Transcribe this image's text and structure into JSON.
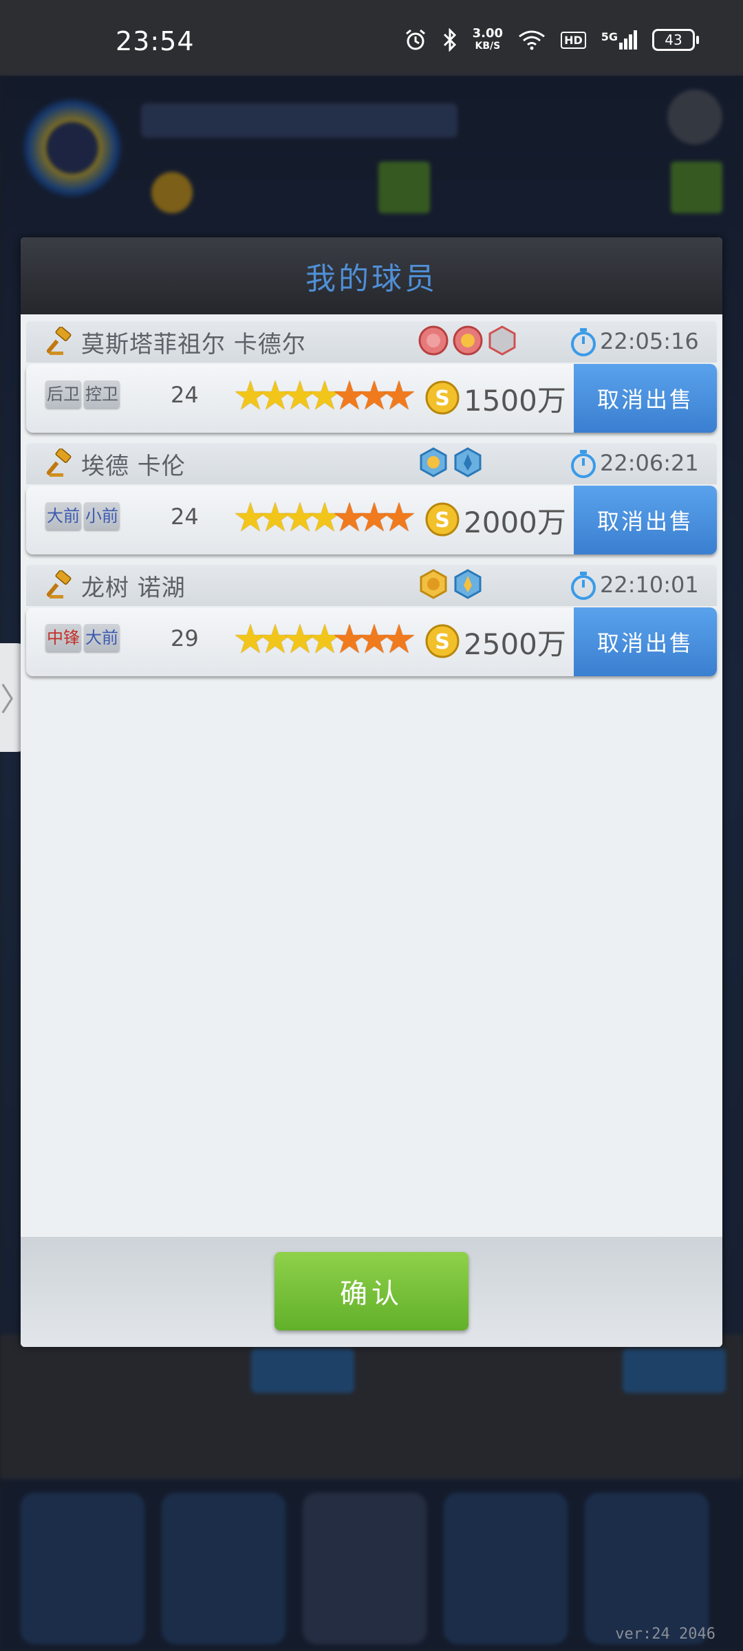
{
  "status_bar": {
    "time": "23:54",
    "net_speed": "3.00",
    "net_unit": "KB/S",
    "hd": "HD",
    "net_type": "5G",
    "battery": "43"
  },
  "dialog": {
    "title": "我的球员",
    "confirm_label": "确认",
    "entries": [
      {
        "name": "莫斯塔菲祖尔 卡德尔",
        "time": "22:05:16",
        "positions": [
          "后卫",
          "控卫"
        ],
        "age": "24",
        "price": "1500万",
        "cancel_label": "取消出售"
      },
      {
        "name": "埃德 卡伦",
        "time": "22:06:21",
        "positions": [
          "大前",
          "小前"
        ],
        "age": "24",
        "price": "2000万",
        "cancel_label": "取消出售"
      },
      {
        "name": "龙树 诺湖",
        "time": "22:10:01",
        "positions": [
          "中锋",
          "大前"
        ],
        "age": "29",
        "price": "2500万",
        "cancel_label": "取消出售"
      }
    ]
  },
  "version": "ver:24 2046",
  "colors": {
    "accent_blue": "#3a7fd0",
    "confirm_green": "#62b02a",
    "star_yellow": "#f2c51a",
    "star_orange": "#f07a1e"
  }
}
